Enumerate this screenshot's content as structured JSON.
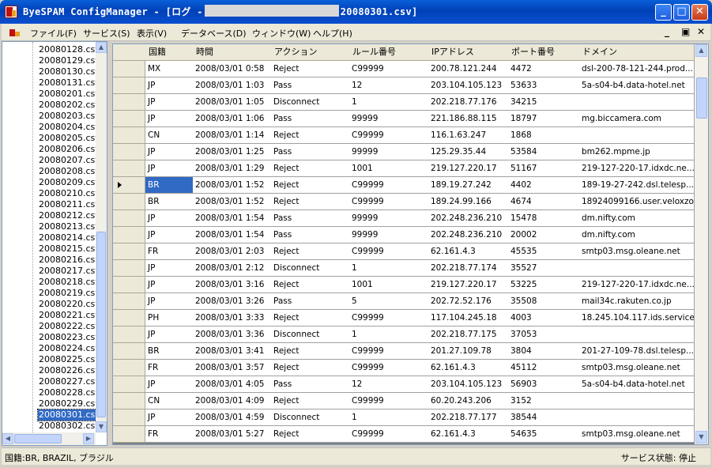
{
  "window": {
    "title_prefix": "ByeSPAM ConfigManager - [ログ -",
    "title_suffix": "20080301.csv]",
    "minimize_glyph": "_",
    "maximize_glyph": "□",
    "close_glyph": "✕",
    "icon": "byespam-app-icon"
  },
  "menu": {
    "items": [
      "ファイル(F)",
      "サービス(S)",
      "表示(V)",
      "データベース(D)",
      "ウィンドウ(W)",
      "ヘルプ(H)"
    ],
    "mdi_minimize": "_",
    "mdi_restore": "▣",
    "mdi_close": "✕"
  },
  "files": {
    "items": [
      "20080128.csv",
      "20080129.csv",
      "20080130.csv",
      "20080131.csv",
      "20080201.csv",
      "20080202.csv",
      "20080203.csv",
      "20080204.csv",
      "20080205.csv",
      "20080206.csv",
      "20080207.csv",
      "20080208.csv",
      "20080209.csv",
      "20080210.csv",
      "20080211.csv",
      "20080212.csv",
      "20080213.csv",
      "20080214.csv",
      "20080215.csv",
      "20080216.csv",
      "20080217.csv",
      "20080218.csv",
      "20080219.csv",
      "20080220.csv",
      "20080221.csv",
      "20080222.csv",
      "20080223.csv",
      "20080224.csv",
      "20080225.csv",
      "20080226.csv",
      "20080227.csv",
      "20080228.csv",
      "20080229.csv",
      "20080301.csv",
      "20080302.csv"
    ],
    "selected": "20080301.csv"
  },
  "grid": {
    "columns": [
      "国籍",
      "時間",
      "アクション",
      "ルール番号",
      "IPアドレス",
      "ポート番号",
      "ドメイン"
    ],
    "rows": [
      [
        "MX",
        "2008/03/01 0:58",
        "Reject",
        "C99999",
        "200.78.121.244",
        "4472",
        "dsl-200-78-121-244.prod..."
      ],
      [
        "JP",
        "2008/03/01 1:03",
        "Pass",
        "12",
        "203.104.105.123",
        "53633",
        "5a-s04-b4.data-hotel.net"
      ],
      [
        "JP",
        "2008/03/01 1:05",
        "Disconnect",
        "1",
        "202.218.77.176",
        "34215",
        ""
      ],
      [
        "JP",
        "2008/03/01 1:06",
        "Pass",
        "99999",
        "221.186.88.115",
        "18797",
        "mg.biccamera.com"
      ],
      [
        "CN",
        "2008/03/01 1:14",
        "Reject",
        "C99999",
        "116.1.63.247",
        "1868",
        ""
      ],
      [
        "JP",
        "2008/03/01 1:25",
        "Pass",
        "99999",
        "125.29.35.44",
        "53584",
        "bm262.mpme.jp"
      ],
      [
        "JP",
        "2008/03/01 1:29",
        "Reject",
        "1001",
        "219.127.220.17",
        "51167",
        "219-127-220-17.idxdc.ne..."
      ],
      [
        "BR",
        "2008/03/01 1:52",
        "Reject",
        "C99999",
        "189.19.27.242",
        "4402",
        "189-19-27-242.dsl.telesp..."
      ],
      [
        "BR",
        "2008/03/01 1:52",
        "Reject",
        "C99999",
        "189.24.99.166",
        "4674",
        "18924099166.user.veloxzo..."
      ],
      [
        "JP",
        "2008/03/01 1:54",
        "Pass",
        "99999",
        "202.248.236.210",
        "15478",
        "dm.nifty.com"
      ],
      [
        "JP",
        "2008/03/01 1:54",
        "Pass",
        "99999",
        "202.248.236.210",
        "20002",
        "dm.nifty.com"
      ],
      [
        "FR",
        "2008/03/01 2:03",
        "Reject",
        "C99999",
        "62.161.4.3",
        "45535",
        "smtp03.msg.oleane.net"
      ],
      [
        "JP",
        "2008/03/01 2:12",
        "Disconnect",
        "1",
        "202.218.77.174",
        "35527",
        ""
      ],
      [
        "JP",
        "2008/03/01 3:16",
        "Reject",
        "1001",
        "219.127.220.17",
        "53225",
        "219-127-220-17.idxdc.ne..."
      ],
      [
        "JP",
        "2008/03/01 3:26",
        "Pass",
        "5",
        "202.72.52.176",
        "35508",
        "mail34c.rakuten.co.jp"
      ],
      [
        "PH",
        "2008/03/01 3:33",
        "Reject",
        "C99999",
        "117.104.245.18",
        "4003",
        "18.245.104.117.ids.service..."
      ],
      [
        "JP",
        "2008/03/01 3:36",
        "Disconnect",
        "1",
        "202.218.77.175",
        "37053",
        ""
      ],
      [
        "BR",
        "2008/03/01 3:41",
        "Reject",
        "C99999",
        "201.27.109.78",
        "3804",
        "201-27-109-78.dsl.telesp..."
      ],
      [
        "FR",
        "2008/03/01 3:57",
        "Reject",
        "C99999",
        "62.161.4.3",
        "45112",
        "smtp03.msg.oleane.net"
      ],
      [
        "JP",
        "2008/03/01 4:05",
        "Pass",
        "12",
        "203.104.105.123",
        "56903",
        "5a-s04-b4.data-hotel.net"
      ],
      [
        "CN",
        "2008/03/01 4:09",
        "Reject",
        "C99999",
        "60.20.243.206",
        "3152",
        ""
      ],
      [
        "JP",
        "2008/03/01 4:59",
        "Disconnect",
        "1",
        "202.218.77.177",
        "38544",
        ""
      ],
      [
        "FR",
        "2008/03/01 5:27",
        "Reject",
        "C99999",
        "62.161.4.3",
        "54635",
        "smtp03.msg.oleane.net"
      ]
    ],
    "current_row": 7,
    "selected_cell": [
      7,
      0
    ]
  },
  "status": {
    "left": "国籍:BR, BRAZIL, ブラジル",
    "right": "サービス状態: 停止"
  }
}
